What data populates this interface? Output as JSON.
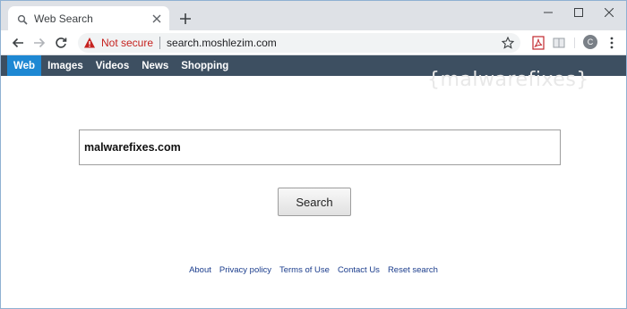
{
  "browser": {
    "tab": {
      "title": "Web Search",
      "favicon": "search-icon"
    },
    "omnibox": {
      "security_label": "Not secure",
      "url": "search.moshlezim.com"
    },
    "profile_initial": "C",
    "colors": {
      "tabstrip": "#dee1e6",
      "warning_red": "#c5221f"
    }
  },
  "site": {
    "nav": [
      {
        "label": "Web",
        "active": true
      },
      {
        "label": "Images",
        "active": false
      },
      {
        "label": "Videos",
        "active": false
      },
      {
        "label": "News",
        "active": false
      },
      {
        "label": "Shopping",
        "active": false
      }
    ],
    "watermark": "{malwarefixes}",
    "search": {
      "value": "malwarefixes.com",
      "button_label": "Search"
    },
    "footer_links": [
      "About",
      "Privacy policy",
      "Terms of Use",
      "Contact Us",
      "Reset search"
    ],
    "colors": {
      "navbar": "#3d4f61",
      "nav_active": "#1e88d3",
      "footer_link": "#1a3c8c"
    }
  }
}
